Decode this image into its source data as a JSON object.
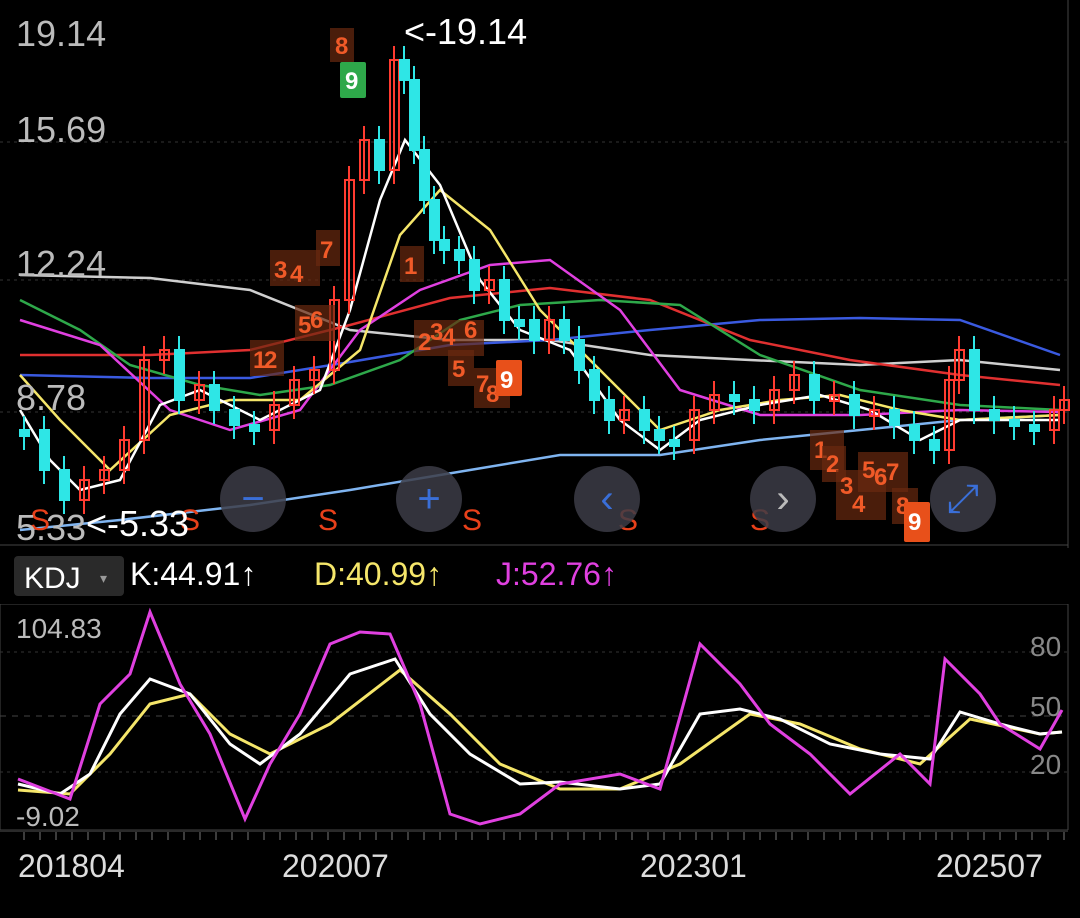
{
  "main_chart": {
    "y_labels": [
      "19.14",
      "15.69",
      "12.24",
      "8.78",
      "5.33"
    ],
    "max_annotation": "<-19.14",
    "min_annotation": "<-5.33",
    "sell_marker": "S",
    "controls": {
      "zoom_out": "−",
      "zoom_in": "+",
      "prev": "‹",
      "next": "›",
      "fullscreen": "⤢"
    }
  },
  "indicator": {
    "name": "KDJ",
    "caret": "▾",
    "k": "K:44.91↑",
    "d": "D:40.99↑",
    "j": "J:52.76↑"
  },
  "sub_chart": {
    "y_max": "104.83",
    "y_min": "-9.02",
    "ref_levels": [
      "80",
      "50",
      "20"
    ]
  },
  "x_labels": [
    "201804",
    "202007",
    "202301",
    "202507"
  ],
  "colors": {
    "up": "#ff3b30",
    "down": "#2ee6e6",
    "k": "#ffffff",
    "d": "#f5e66a",
    "j": "#e040e0",
    "count": "#f05a28",
    "signal": "#2ea84a"
  },
  "chart_data": {
    "type": "candlestick",
    "price_range": [
      5.33,
      19.14
    ],
    "moving_average_colors": [
      "#ffffff",
      "#f5e66a",
      "#e040e0",
      "#2ea84a",
      "#e03030",
      "#3a5ae0",
      "#cfcfcf",
      "#7fb4f0"
    ],
    "td_counts_visible": [
      "8",
      "9",
      "3",
      "4",
      "7",
      "5",
      "6",
      "1",
      "2",
      "3",
      "4",
      "5",
      "6",
      "7",
      "8",
      "9",
      "1",
      "2",
      "3",
      "4",
      "5",
      "6",
      "7",
      "8",
      "9",
      "1",
      "2"
    ],
    "kdj": {
      "k": 44.91,
      "d": 40.99,
      "j": 52.76,
      "range": [
        -9.02,
        104.83
      ]
    }
  }
}
